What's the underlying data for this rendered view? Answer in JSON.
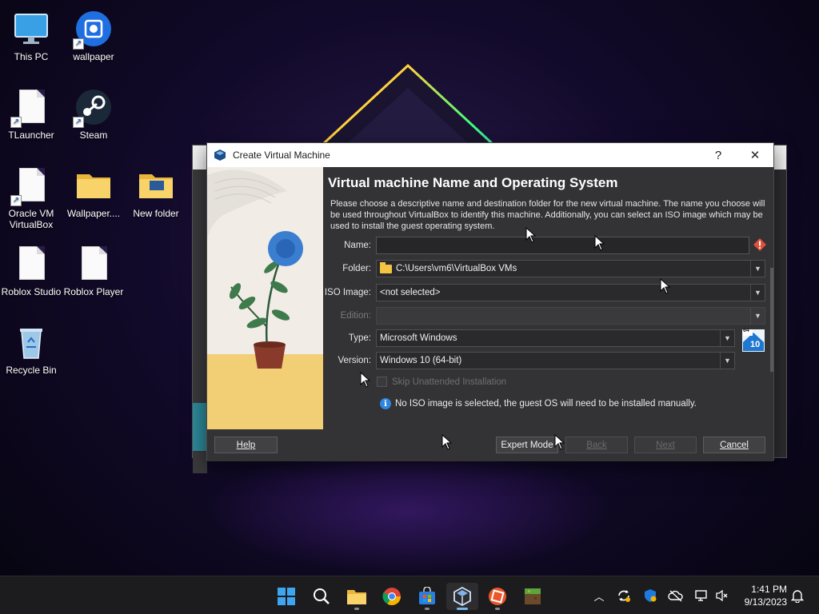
{
  "desktop": {
    "icons": [
      {
        "label": "This PC"
      },
      {
        "label": "wallpaper"
      },
      {
        "label": "TLauncher"
      },
      {
        "label": "Steam"
      },
      {
        "label": "Oracle VM VirtualBox"
      },
      {
        "label": "Wallpaper...."
      },
      {
        "label": "New folder"
      },
      {
        "label": "Roblox Studio"
      },
      {
        "label": "Roblox Player"
      },
      {
        "label": "Recycle Bin"
      }
    ]
  },
  "dialog": {
    "title": "Create Virtual Machine",
    "help_glyph": "?",
    "close_glyph": "✕",
    "heading": "Virtual machine Name and Operating System",
    "description": "Please choose a descriptive name and destination folder for the new virtual machine. The name you choose will be used throughout VirtualBox to identify this machine. Additionally, you can select an ISO image which may be used to install the guest operating system.",
    "fields": {
      "name_label": "Name:",
      "name_value": "",
      "folder_label": "Folder:",
      "folder_value": "C:\\Users\\vm6\\VirtualBox VMs",
      "iso_label": "ISO Image:",
      "iso_value": "<not selected>",
      "edition_label": "Edition:",
      "edition_value": "",
      "type_label": "Type:",
      "type_value": "Microsoft Windows",
      "version_label": "Version:",
      "version_value": "Windows 10 (64-bit)",
      "os_badge_top": "64",
      "os_badge_num": "10"
    },
    "skip_unattended_label": "Skip Unattended Installation",
    "info_text": "No ISO image is selected, the guest OS will need to be installed manually.",
    "buttons": {
      "help": "Help",
      "expert": "Expert Mode",
      "back": "Back",
      "next": "Next",
      "cancel": "Cancel"
    }
  },
  "taskbar": {
    "apps": [
      "start-icon",
      "search-icon",
      "file-explorer-icon",
      "chrome-icon",
      "store-icon",
      "virtualbox-icon",
      "roblox-icon",
      "minecraft-icon"
    ],
    "clock_time": "1:41 PM",
    "clock_date": "9/13/2023"
  },
  "colors": {
    "accent_blue": "#2f86e0",
    "warning_red": "#e0503a",
    "dialog_bg": "#333335"
  }
}
